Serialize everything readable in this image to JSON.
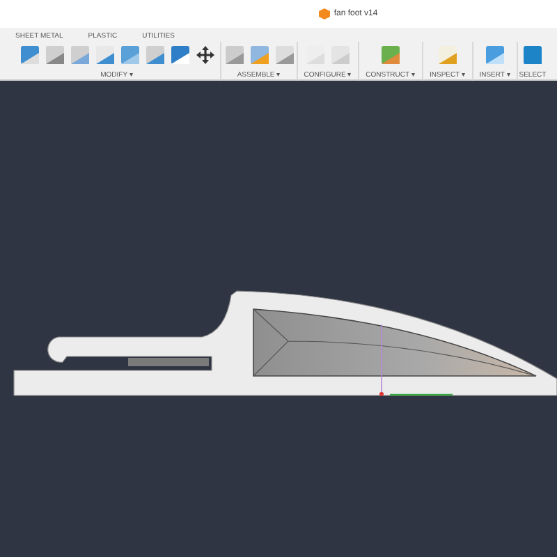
{
  "window": {
    "title": "fan foot v14"
  },
  "tabs": [
    {
      "label": "SHEET METAL",
      "selected": false
    },
    {
      "label": "PLASTIC",
      "selected": false
    },
    {
      "label": "UTILITIES",
      "selected": false
    }
  ],
  "toolbar_groups": [
    {
      "label": "MODIFY ▾",
      "kind": "modify"
    },
    {
      "label": "ASSEMBLE ▾",
      "kind": "assemble"
    },
    {
      "label": "CONFIGURE ▾",
      "kind": "configure"
    },
    {
      "label": "CONSTRUCT ▾",
      "kind": "construct"
    },
    {
      "label": "INSPECT ▾",
      "kind": "inspect"
    },
    {
      "label": "INSERT ▾",
      "kind": "insert"
    },
    {
      "label": "SELECT",
      "kind": "select"
    }
  ]
}
